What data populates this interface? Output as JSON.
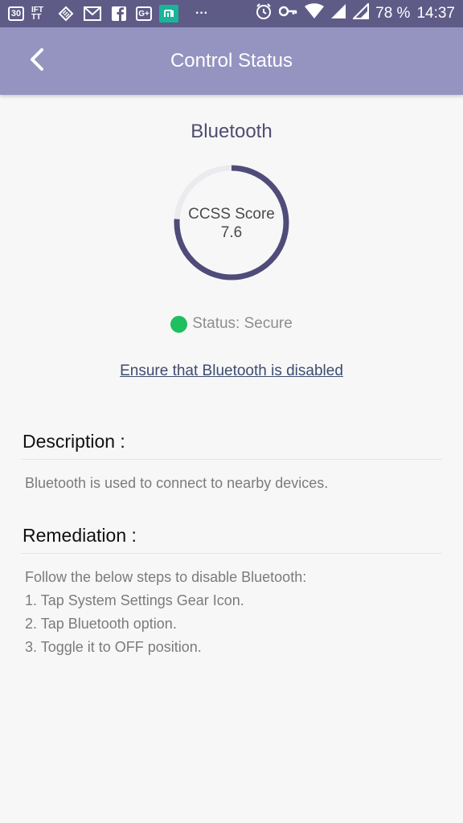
{
  "status_bar": {
    "left_icons": [
      "calendar-30-icon",
      "ifttt-icon",
      "layers-icon",
      "gmail-icon",
      "facebook-icon",
      "google-plus-icon",
      "mi-icon",
      "more-icon"
    ],
    "calendar_day": "30",
    "ifttt_label": "IFT TT",
    "google_plus_label": "G+",
    "more_label": "···",
    "battery": "78 %",
    "time": "14:37"
  },
  "app_bar": {
    "title": "Control Status"
  },
  "control": {
    "name": "Bluetooth",
    "score_label": "CCSS Score",
    "score_value": "7.6",
    "score_fraction": 0.76,
    "status": "Status: Secure",
    "status_color": "#1dbf5f",
    "action_link": "Ensure that Bluetooth is disabled"
  },
  "description": {
    "heading": "Description :",
    "text": "Bluetooth is used to connect to nearby devices."
  },
  "remediation": {
    "heading": "Remediation :",
    "intro": "Follow the below steps to disable Bluetooth:",
    "steps": [
      "1. Tap System Settings Gear Icon.",
      "2. Tap Bluetooth option.",
      "3. Toggle it to OFF position."
    ]
  },
  "colors": {
    "status_bar": "#5f5b87",
    "app_bar": "#9593c0",
    "gauge_ring": "#4f4c7a",
    "gauge_track": "#ebeaef"
  }
}
